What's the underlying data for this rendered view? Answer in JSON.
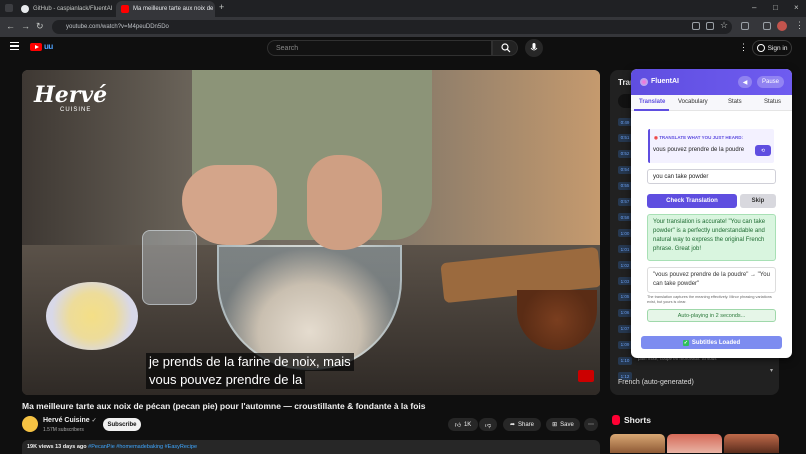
{
  "browser": {
    "tabs": [
      {
        "title": "GitHub - caspianlack/FluentAI"
      },
      {
        "title": "Ma meilleure tarte aux noix de"
      }
    ],
    "url": "youtube.com/watch?v=M4peuDDn5Do"
  },
  "youtube": {
    "search_placeholder": "Search",
    "sign_in": "Sign in"
  },
  "video": {
    "brand": "Hervé",
    "brand_sub": "CUISINE",
    "subtitle_lines": [
      "je prends de la farine de noix, mais",
      "vous pouvez prendre de la"
    ]
  },
  "transcript": {
    "title": "Tran",
    "timestamps": [
      "0:49",
      "0:51",
      "0:52",
      "0:54",
      "0:55",
      "0:57",
      "0:58",
      "1:00",
      "1:01",
      "1:02",
      "1:03",
      "1:05",
      "1:06",
      "1:07",
      "1:09",
      "1:10",
      "1:12"
    ],
    "last_line": "pain mixé, coupé en morceaux. Si vous",
    "language": "French (auto-generated)"
  },
  "meta": {
    "title": "Ma meilleure tarte aux noix de pécan (pecan pie) pour l'automne — croustillante & fondante à la fois",
    "channel": "Hervé Cuisine",
    "subscribers": "1.57M subscribers",
    "subscribe": "Subscribe",
    "likes": "1K",
    "share": "Share",
    "save": "Save",
    "views_date": "19K views  13 days ago",
    "tags": "#PecanPie #homemadebaking #EasyRecipe"
  },
  "shorts": {
    "label": "Shorts"
  },
  "fluentai": {
    "title": "FluentAI",
    "pause": "Pause",
    "tabs": [
      "Translate",
      "Vocabulary",
      "Stats",
      "Status"
    ],
    "prompt_label": "TRANSLATE WHAT YOU JUST HEARD:",
    "phrase": "vous pouvez prendre de la poudre",
    "answer": "you can take powder",
    "check_button": "Check Translation",
    "skip_button": "Skip",
    "feedback": "Your translation is accurate! \"You can take powder\" is a perfectly understandable and natural way to express the original French phrase. Great job!",
    "pair": "\"vous pouvez prendre de la poudre\" → \"You can take powder\"",
    "note": "The translation captures the meaning effectively. Minor phrasing variations exist, but yours is clear.",
    "autoplay": "Auto-playing in 2 seconds...",
    "subtitles_loaded": "Subtitles Loaded"
  },
  "colors": {
    "accent": "#5f4ee0",
    "youtube_red": "#ff0000",
    "success_bg": "#d9f5df"
  }
}
